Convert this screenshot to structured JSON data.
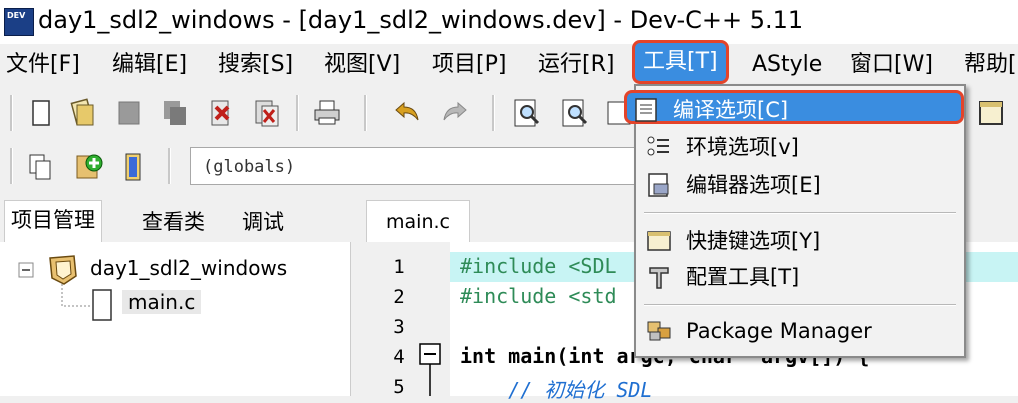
{
  "window": {
    "title": "day1_sdl2_windows - [day1_sdl2_windows.dev] - Dev-C++ 5.11"
  },
  "menubar": {
    "file": "文件[F]",
    "edit": "编辑[E]",
    "search": "搜索[S]",
    "view": "视图[V]",
    "project": "项目[P]",
    "run": "运行[R]",
    "tools": "工具[T]",
    "astyle": "AStyle",
    "window": "窗口[W]",
    "help": "帮助["
  },
  "toolbar": {
    "scope_combo": "(globals)"
  },
  "left_panel": {
    "tabs": {
      "project": "项目管理",
      "classes": "查看类",
      "debug": "调试"
    },
    "tree": {
      "project_name": "day1_sdl2_windows",
      "file": "main.c"
    }
  },
  "editor": {
    "tab": "main.c",
    "lines": [
      {
        "num": "1",
        "code": "#include <SDL"
      },
      {
        "num": "2",
        "code": "#include <std"
      },
      {
        "num": "3",
        "code": ""
      },
      {
        "num": "4",
        "code": "int main(int argc, char *argv[]) {"
      },
      {
        "num": "5",
        "code": "    // 初始化 SDL"
      }
    ]
  },
  "tools_menu": {
    "compiler_options": "编译选项[C]",
    "environment_options": "环境选项[v]",
    "editor_options": "编辑器选项[E]",
    "shortcut_options": "快捷键选项[Y]",
    "configure_tools": "配置工具[T]",
    "package_manager": "Package Manager"
  },
  "colors": {
    "highlight": "#3a8de0",
    "callout_red": "#e4442a",
    "preprocessor_green": "#2e8b57",
    "comment_blue": "#1f6fd1"
  },
  "icons": [
    "app-icon",
    "new-file-icon",
    "open-icon",
    "save-icon",
    "save-all-icon",
    "close-icon",
    "close-all-icon",
    "print-icon",
    "undo-icon",
    "redo-icon",
    "find-icon",
    "replace-icon",
    "add-file-icon",
    "remove-file-icon",
    "bookmark-icon",
    "compiler-options-icon",
    "environment-options-icon",
    "editor-options-icon",
    "shortcut-options-icon",
    "configure-tools-icon",
    "package-manager-icon",
    "fold-minus-icon",
    "tree-collapse-icon",
    "project-icon",
    "file-icon"
  ]
}
